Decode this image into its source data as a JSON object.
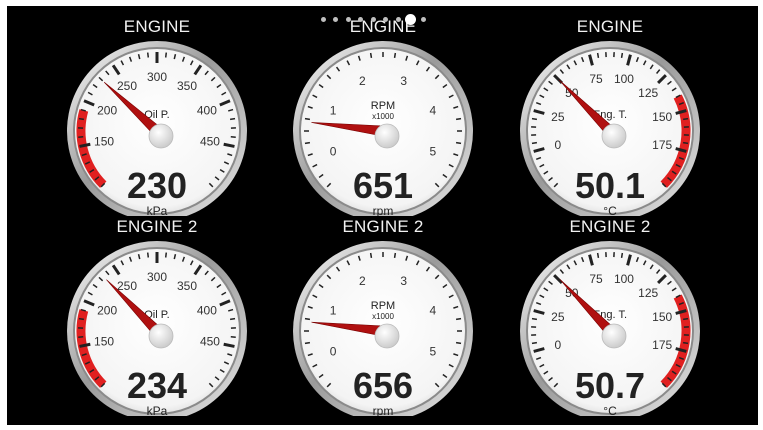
{
  "pager": {
    "count": 9,
    "active_index": 7
  },
  "colors": {
    "background": "#000000",
    "redline": "#e02020",
    "needle": "#b01010",
    "dial": "#ffffff",
    "text": "#222222"
  },
  "gauges": [
    {
      "title": "ENGINE",
      "label": "Oil P.",
      "sublabel": "",
      "value": "230",
      "unit": "kPa",
      "scale_labels": [
        "150",
        "200",
        "250",
        "300",
        "350",
        "400",
        "450"
      ],
      "scale_min": 100,
      "scale_max": 500,
      "needle_value": 230,
      "redline_range": [
        100,
        190
      ],
      "needle_icon": "needle-icon"
    },
    {
      "title": "ENGINE",
      "label": "RPM",
      "sublabel": "x1000",
      "value": "651",
      "unit": "rpm",
      "scale_labels": [
        "0",
        "1",
        "2",
        "3",
        "4",
        "5"
      ],
      "scale_min": -0.5,
      "scale_max": 5.5,
      "needle_value": 0.651,
      "redline_range": null,
      "needle_icon": "needle-icon"
    },
    {
      "title": "ENGINE",
      "label": "Eng. T.",
      "sublabel": "",
      "value": "50.1",
      "unit": "°C",
      "scale_labels": [
        "0",
        "25",
        "50",
        "75",
        "100",
        "125",
        "150",
        "175"
      ],
      "scale_min": -25,
      "scale_max": 200,
      "needle_value": 50.1,
      "redline_range": [
        140,
        200
      ],
      "needle_icon": "needle-icon"
    },
    {
      "title": "ENGINE 2",
      "label": "Oil P.",
      "sublabel": "",
      "value": "234",
      "unit": "kPa",
      "scale_labels": [
        "150",
        "200",
        "250",
        "300",
        "350",
        "400",
        "450"
      ],
      "scale_min": 100,
      "scale_max": 500,
      "needle_value": 234,
      "redline_range": [
        100,
        190
      ],
      "needle_icon": "needle-icon"
    },
    {
      "title": "ENGINE 2",
      "label": "RPM",
      "sublabel": "x1000",
      "value": "656",
      "unit": "rpm",
      "scale_labels": [
        "0",
        "1",
        "2",
        "3",
        "4",
        "5"
      ],
      "scale_min": -0.5,
      "scale_max": 5.5,
      "needle_value": 0.656,
      "redline_range": null,
      "needle_icon": "needle-icon"
    },
    {
      "title": "ENGINE 2",
      "label": "Eng. T.",
      "sublabel": "",
      "value": "50.7",
      "unit": "°C",
      "scale_labels": [
        "0",
        "25",
        "50",
        "75",
        "100",
        "125",
        "150",
        "175"
      ],
      "scale_min": -25,
      "scale_max": 200,
      "needle_value": 50.7,
      "redline_range": [
        140,
        200
      ],
      "needle_icon": "needle-icon"
    }
  ]
}
